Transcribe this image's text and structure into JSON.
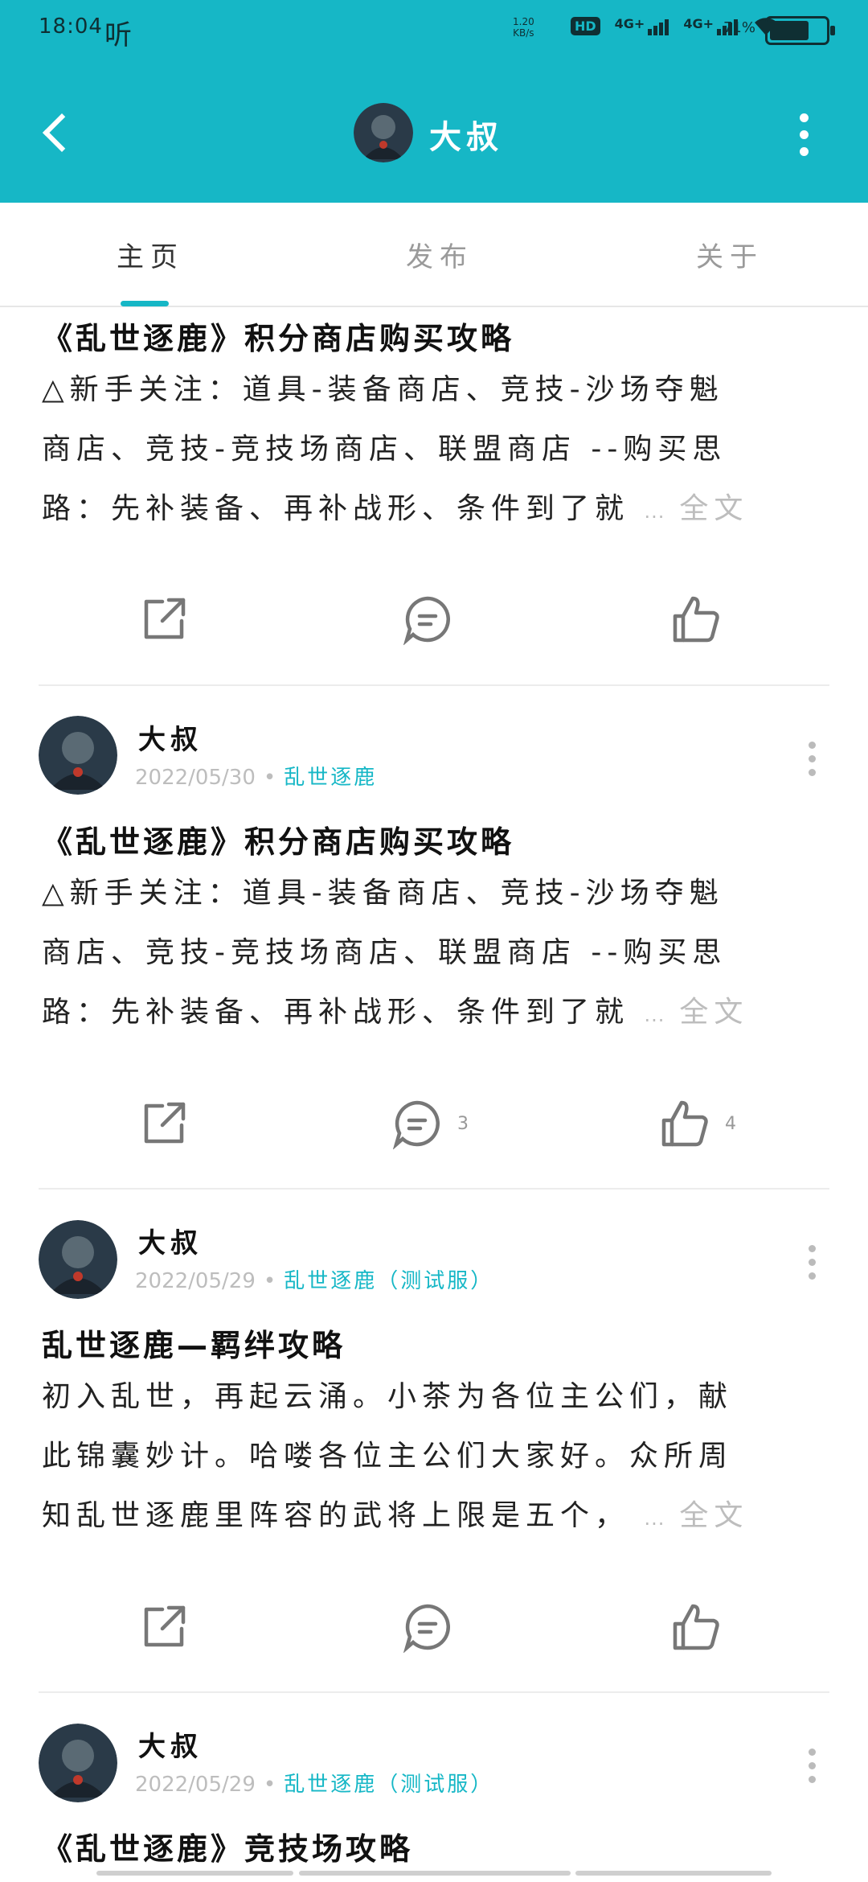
{
  "status_bar": {
    "time": "18:04",
    "extra": "听",
    "net_speed": "1.20",
    "net_unit": "KB/s",
    "hd_label": "HD",
    "sim1": "4G+",
    "sim2": "4G+",
    "battery_percent": "71%",
    "battery_level": 0.71
  },
  "header": {
    "title": "大叔",
    "back_icon": "chevron-left-icon",
    "more_icon": "more-vertical-icon"
  },
  "tabs": [
    {
      "label": "主页",
      "active": true
    },
    {
      "label": "发布",
      "active": false
    },
    {
      "label": "关于",
      "active": false
    }
  ],
  "colors": {
    "accent": "#16b7c6"
  },
  "posts": [
    {
      "title": "《乱世逐鹿》积分商店购买攻略",
      "lines": [
        "△新手关注：道具-装备商店、竞技-沙场夺魁",
        "商店、竞技-竞技场商店、联盟商店 --购买思",
        "路：先补装备、再补战形、条件到了就"
      ],
      "ellipsis": "...",
      "more_label": "全文",
      "comments": "",
      "likes": ""
    },
    {
      "author": "大叔",
      "date": "2022/05/30",
      "category": "乱世逐鹿",
      "title": "《乱世逐鹿》积分商店购买攻略",
      "lines": [
        "△新手关注：道具-装备商店、竞技-沙场夺魁",
        "商店、竞技-竞技场商店、联盟商店 --购买思",
        "路：先补装备、再补战形、条件到了就"
      ],
      "ellipsis": "...",
      "more_label": "全文",
      "comments": "3",
      "likes": "4"
    },
    {
      "author": "大叔",
      "date": "2022/05/29",
      "category": "乱世逐鹿（测试服）",
      "title": "乱世逐鹿—羁绊攻略",
      "lines": [
        "初入乱世，再起云涌。小茶为各位主公们，献",
        "此锦囊妙计。哈喽各位主公们大家好。众所周",
        "知乱世逐鹿里阵容的武将上限是五个，"
      ],
      "ellipsis": "...",
      "more_label": "全文",
      "comments": "",
      "likes": ""
    },
    {
      "author": "大叔",
      "date": "2022/05/29",
      "category": "乱世逐鹿（测试服）",
      "title": "《乱世逐鹿》竞技场攻略"
    }
  ]
}
